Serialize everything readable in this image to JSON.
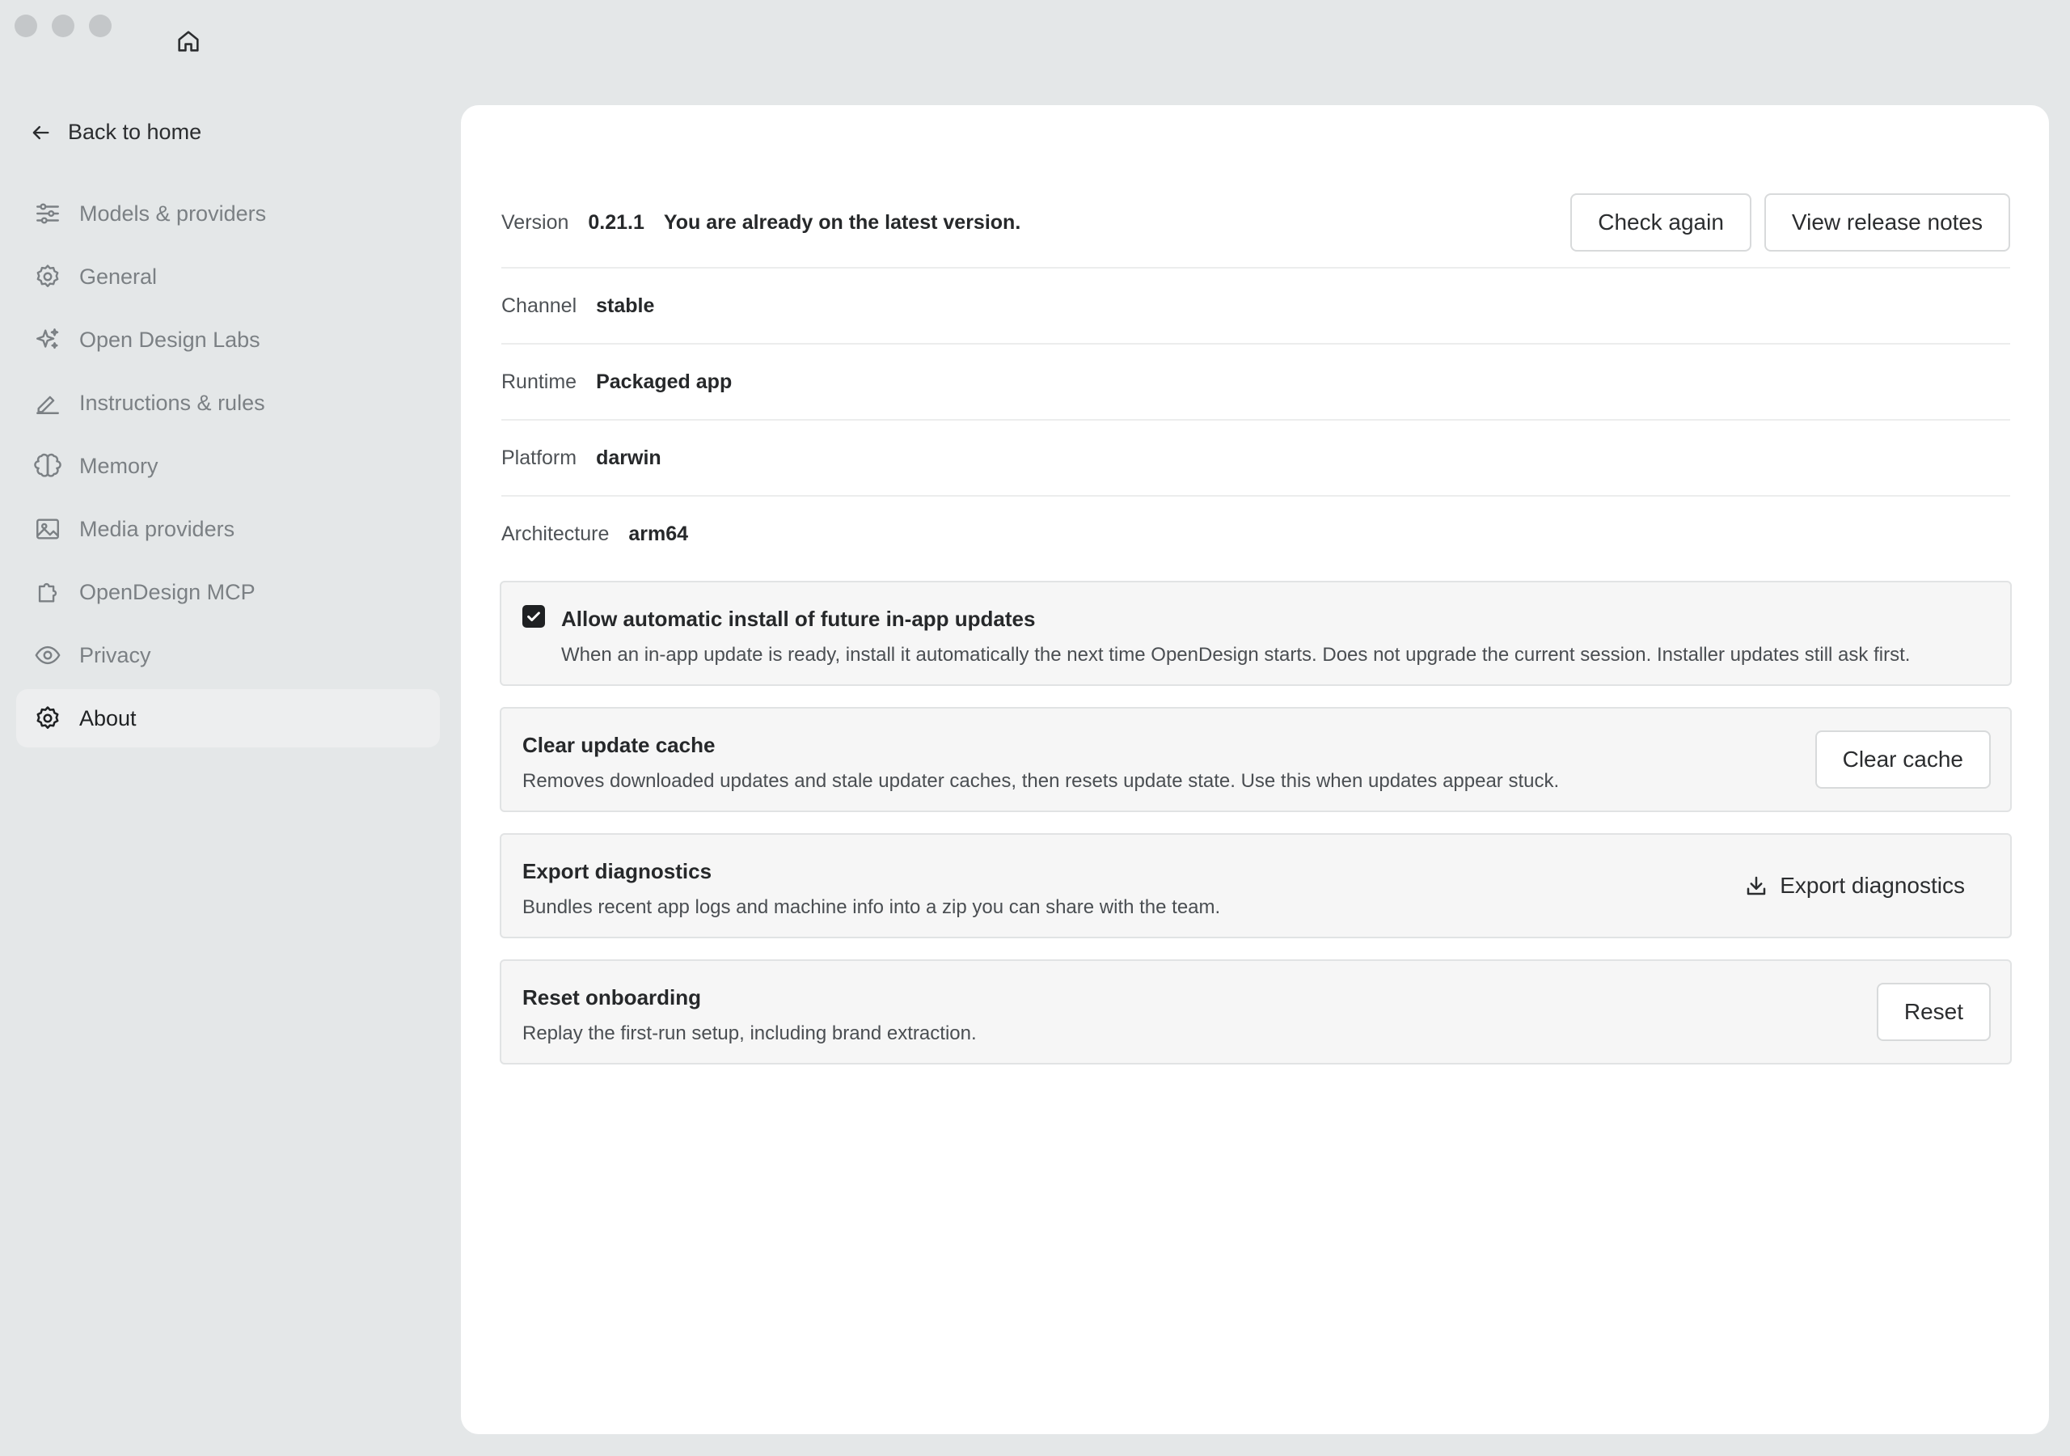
{
  "sidebar": {
    "back_label": "Back to home",
    "items": [
      {
        "label": "Models & providers",
        "icon": "sliders-icon"
      },
      {
        "label": "General",
        "icon": "gear-icon"
      },
      {
        "label": "Open Design Labs",
        "icon": "sparkles-icon"
      },
      {
        "label": "Instructions & rules",
        "icon": "pencil-icon"
      },
      {
        "label": "Memory",
        "icon": "brain-icon"
      },
      {
        "label": "Media providers",
        "icon": "image-icon"
      },
      {
        "label": "OpenDesign MCP",
        "icon": "puzzle-icon"
      },
      {
        "label": "Privacy",
        "icon": "eye-icon"
      },
      {
        "label": "About",
        "icon": "gear-icon",
        "active": true
      }
    ]
  },
  "about": {
    "version_label": "Version",
    "version_value": "0.21.1",
    "version_status": "You are already on the latest version.",
    "check_again_label": "Check again",
    "release_notes_label": "View release notes",
    "channel_label": "Channel",
    "channel_value": "stable",
    "runtime_label": "Runtime",
    "runtime_value": "Packaged app",
    "platform_label": "Platform",
    "platform_value": "darwin",
    "architecture_label": "Architecture",
    "architecture_value": "arm64"
  },
  "cards": {
    "auto_install": {
      "checked": true,
      "title": "Allow automatic install of future in-app updates",
      "desc": "When an in-app update is ready, install it automatically the next time OpenDesign starts. Does not upgrade the current session. Installer updates still ask first."
    },
    "clear_cache": {
      "title": "Clear update cache",
      "desc": "Removes downloaded updates and stale updater caches, then resets update state. Use this when updates appear stuck.",
      "button": "Clear cache"
    },
    "export": {
      "title": "Export diagnostics",
      "desc": "Bundles recent app logs and machine info into a zip you can share with the team.",
      "button": "Export diagnostics"
    },
    "reset": {
      "title": "Reset onboarding",
      "desc": "Replay the first-run setup, including brand extraction.",
      "button": "Reset"
    }
  }
}
